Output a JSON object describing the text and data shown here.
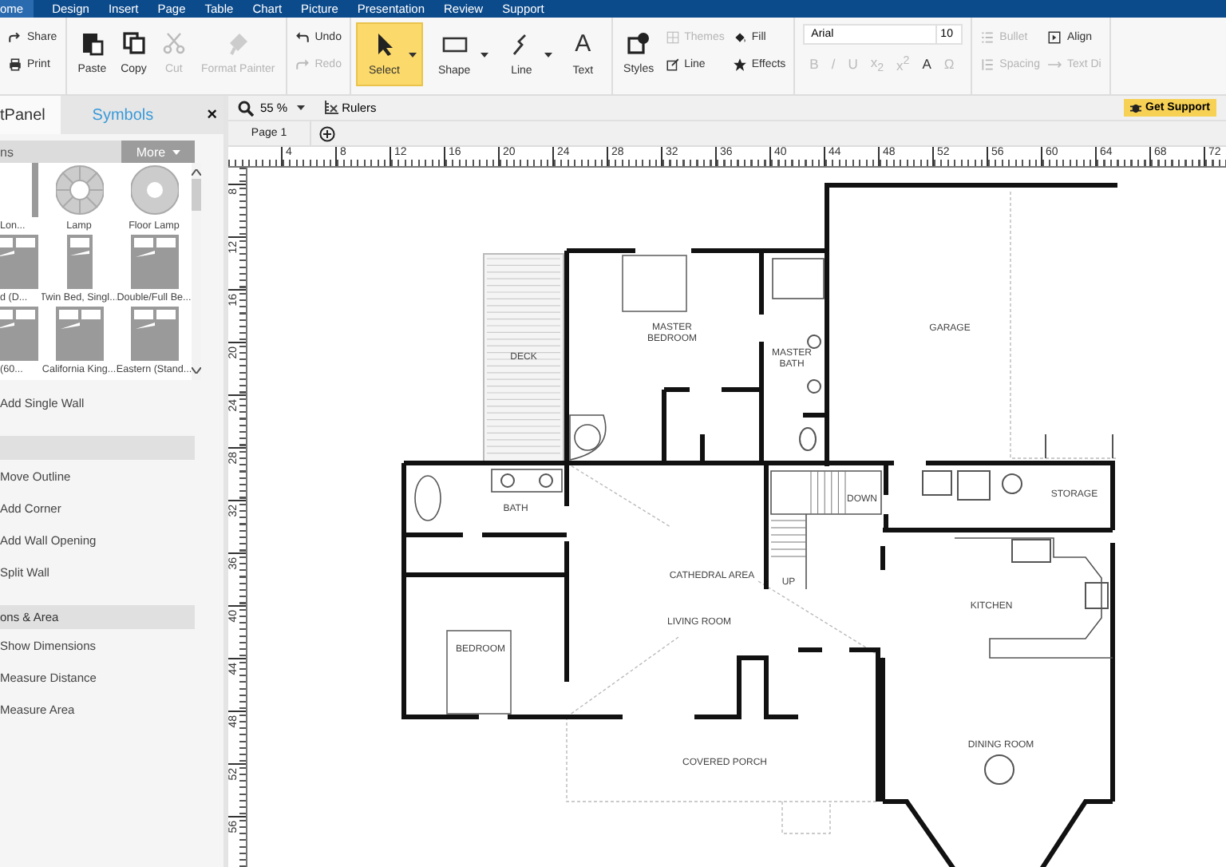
{
  "menu": [
    {
      "label": "ome",
      "selected": true
    },
    {
      "label": "Design",
      "selected": false
    },
    {
      "label": "Insert",
      "selected": false
    },
    {
      "label": "Page",
      "selected": false
    },
    {
      "label": "Table",
      "selected": false
    },
    {
      "label": "Chart",
      "selected": false
    },
    {
      "label": "Picture",
      "selected": false
    },
    {
      "label": "Presentation",
      "selected": false
    },
    {
      "label": "Review",
      "selected": false
    },
    {
      "label": "Support",
      "selected": false
    }
  ],
  "ribbon": [
    {
      "kind": "buttons",
      "columns": [
        [
          {
            "label": "Share",
            "kind": "share",
            "disabled": false
          },
          {
            "label": "Print",
            "kind": "print",
            "disabled": false
          }
        ]
      ]
    },
    {
      "kind": "buttons",
      "columns": [
        [
          {
            "label": "Paste",
            "kind": "paste",
            "disabled": false
          }
        ],
        [
          {
            "label": "Copy",
            "kind": "copy",
            "disabled": false
          }
        ],
        [
          {
            "label": "Cut",
            "kind": "cut",
            "disabled": true
          }
        ],
        [
          {
            "label": "Format Painter",
            "kind": "painter",
            "disabled": true
          }
        ]
      ]
    },
    {
      "kind": "buttons",
      "columns": [
        [
          {
            "label": "Undo",
            "kind": "undo",
            "disabled": false
          },
          {
            "label": "Redo",
            "kind": "redo",
            "disabled": true
          }
        ]
      ]
    },
    {
      "kind": "tools",
      "items": [
        {
          "label": "Select",
          "kind": "select",
          "selected": true,
          "dropdown": true
        },
        {
          "label": "Shape",
          "kind": "shape",
          "selected": false,
          "dropdown": true
        },
        {
          "label": "Line",
          "kind": "line",
          "selected": false,
          "dropdown": true
        },
        {
          "label": "Text",
          "kind": "text",
          "glyph": "A",
          "selected": false,
          "dropdown": false
        }
      ]
    },
    {
      "kind": "buttons",
      "columns": [
        [
          {
            "label": "Styles",
            "kind": "styles",
            "disabled": false
          }
        ],
        [
          {
            "label": "Themes",
            "kind": "themes",
            "disabled": true
          },
          {
            "label": "Line",
            "kind": "pen",
            "disabled": false
          }
        ],
        [
          {
            "label": "Fill",
            "kind": "fill",
            "disabled": false
          },
          {
            "label": "Effects",
            "kind": "effects",
            "disabled": false
          }
        ]
      ]
    },
    {
      "kind": "font",
      "family": "Arial",
      "size": "10",
      "formats": [
        {
          "label": "B",
          "disabled": true
        },
        {
          "label": "/",
          "disabled": true
        },
        {
          "label": "U",
          "disabled": true
        },
        {
          "label": "x$_{2}$",
          "disabled": true
        },
        {
          "label": "x$^{2}$",
          "disabled": true
        },
        {
          "label": "A",
          "disabled": false
        },
        {
          "label": "Ω",
          "disabled": true
        }
      ]
    },
    {
      "kind": "buttons",
      "columns": [
        [
          {
            "label": "Bullet",
            "kind": "bullet",
            "disabled": true
          },
          {
            "label": "Spacing",
            "kind": "spacing",
            "disabled": true
          }
        ],
        [
          {
            "label": "Align",
            "kind": "align",
            "disabled": false
          },
          {
            "label": "Text Di",
            "kind": "textdir",
            "disabled": true
          }
        ]
      ]
    }
  ],
  "panel": {
    "tabs": [
      {
        "label": "tPanel",
        "selected": false
      },
      {
        "label": "Symbols",
        "selected": true
      }
    ],
    "close": "×",
    "library": {
      "title": "ns",
      "more": "More",
      "symbols": [
        {
          "label": "Lon...",
          "kind": "strip"
        },
        {
          "label": "Lamp",
          "kind": "lamp"
        },
        {
          "label": "Floor Lamp",
          "kind": "floor-lamp"
        },
        {
          "label": "d (D...",
          "kind": "double-bed"
        },
        {
          "label": "Twin Bed, Singl...",
          "kind": "single-bed"
        },
        {
          "label": "Double/Full Be...",
          "kind": "double-bed"
        },
        {
          "label": "(60...",
          "kind": "double-bed"
        },
        {
          "label": "California King...",
          "kind": "double-bed"
        },
        {
          "label": "Eastern  (Stand...",
          "kind": "double-bed"
        }
      ]
    },
    "sections": [
      {
        "items": [
          "Add Single Wall"
        ]
      },
      {
        "items": [
          "Move Outline",
          "Add Corner",
          "Add Wall Opening",
          "Split Wall"
        ]
      },
      {
        "title": "ons & Area",
        "items": [
          "Show Dimensions",
          "Measure Distance",
          "Measure Area"
        ]
      }
    ]
  },
  "canvas": {
    "zoom": "55 %",
    "rulers": "Rulers",
    "support": "Get Support",
    "pages": [
      {
        "label": "Page 1",
        "selected": true
      }
    ],
    "x_ruler": [
      "4",
      "8",
      "12",
      "16",
      "20",
      "24",
      "28",
      "32",
      "36",
      "40",
      "44",
      "48",
      "52",
      "56",
      "60",
      "64",
      "68",
      "72"
    ],
    "y_ruler": [
      "8",
      "12",
      "16",
      "20",
      "24",
      "28",
      "32",
      "36",
      "40",
      "44",
      "48",
      "52",
      "56"
    ],
    "rooms": [
      {
        "lines": [
          "DECK"
        ]
      },
      {
        "lines": [
          "MASTER",
          "BEDROOM"
        ]
      },
      {
        "lines": [
          "MASTER",
          "BATH"
        ]
      },
      {
        "lines": [
          "GARAGE"
        ]
      },
      {
        "lines": [
          "BATH"
        ]
      },
      {
        "lines": [
          "DOWN"
        ]
      },
      {
        "lines": [
          "STORAGE"
        ]
      },
      {
        "lines": [
          "CATHEDRAL AREA"
        ]
      },
      {
        "lines": [
          "UP"
        ]
      },
      {
        "lines": [
          "KITCHEN"
        ]
      },
      {
        "lines": [
          "LIVING ROOM"
        ]
      },
      {
        "lines": [
          "BEDROOM"
        ]
      },
      {
        "lines": [
          "COVERED PORCH"
        ]
      },
      {
        "lines": [
          "DINING ROOM"
        ]
      }
    ]
  }
}
